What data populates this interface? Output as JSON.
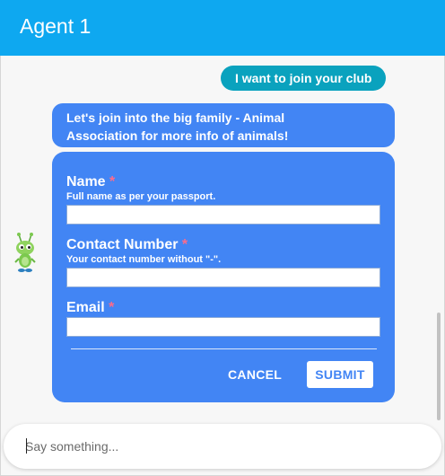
{
  "header": {
    "title": "Agent 1"
  },
  "messages": {
    "user": "I want to join your club",
    "bot_line1": "Let's join into the big family - Animal",
    "bot_line2": "Association for more info of animals!"
  },
  "form": {
    "name_label": "Name",
    "name_hint": "Full name as per your passport.",
    "name_value": "",
    "contact_label": "Contact Number",
    "contact_hint": "Your contact number without \"-\".",
    "contact_value": "",
    "email_label": "Email",
    "email_value": "",
    "required_mark": "*",
    "cancel_label": "CANCEL",
    "submit_label": "SUBMIT"
  },
  "composer": {
    "placeholder": "Say something...",
    "value": ""
  },
  "colors": {
    "header": "#0ea8f0",
    "user_bubble": "#0aa2be",
    "bot_bubble": "#4285f4",
    "required": "#ff6b8a"
  },
  "icons": {
    "avatar": "green-robot-mascot-icon"
  }
}
